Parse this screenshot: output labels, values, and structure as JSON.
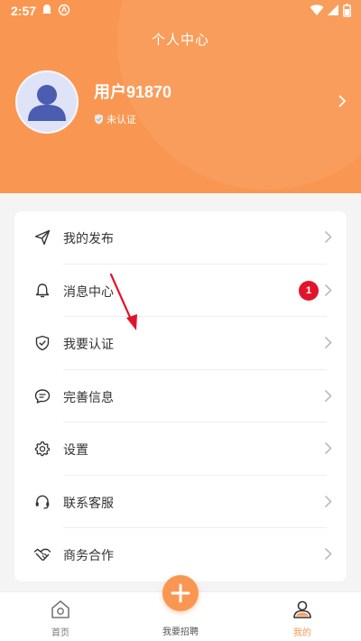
{
  "status_bar": {
    "time": "2:57"
  },
  "header": {
    "title": "个人中心",
    "username": "用户91870",
    "verify_status": "未认证"
  },
  "menu": {
    "items": [
      {
        "label": "我的发布",
        "icon": "paper-plane-icon"
      },
      {
        "label": "消息中心",
        "icon": "bell-icon",
        "badge": "1"
      },
      {
        "label": "我要认证",
        "icon": "shield-check-icon"
      },
      {
        "label": "完善信息",
        "icon": "chat-bubble-icon"
      },
      {
        "label": "设置",
        "icon": "gear-icon"
      },
      {
        "label": "联系客服",
        "icon": "headset-icon"
      },
      {
        "label": "商务合作",
        "icon": "handshake-icon"
      }
    ]
  },
  "tabbar": {
    "home_label": "首页",
    "post_label": "我要招聘",
    "mine_label": "我的"
  },
  "colors": {
    "accent": "#f99752",
    "badge": "#e2142d",
    "avatar_figure": "#4a5db0",
    "active_tab": "#f99752"
  }
}
